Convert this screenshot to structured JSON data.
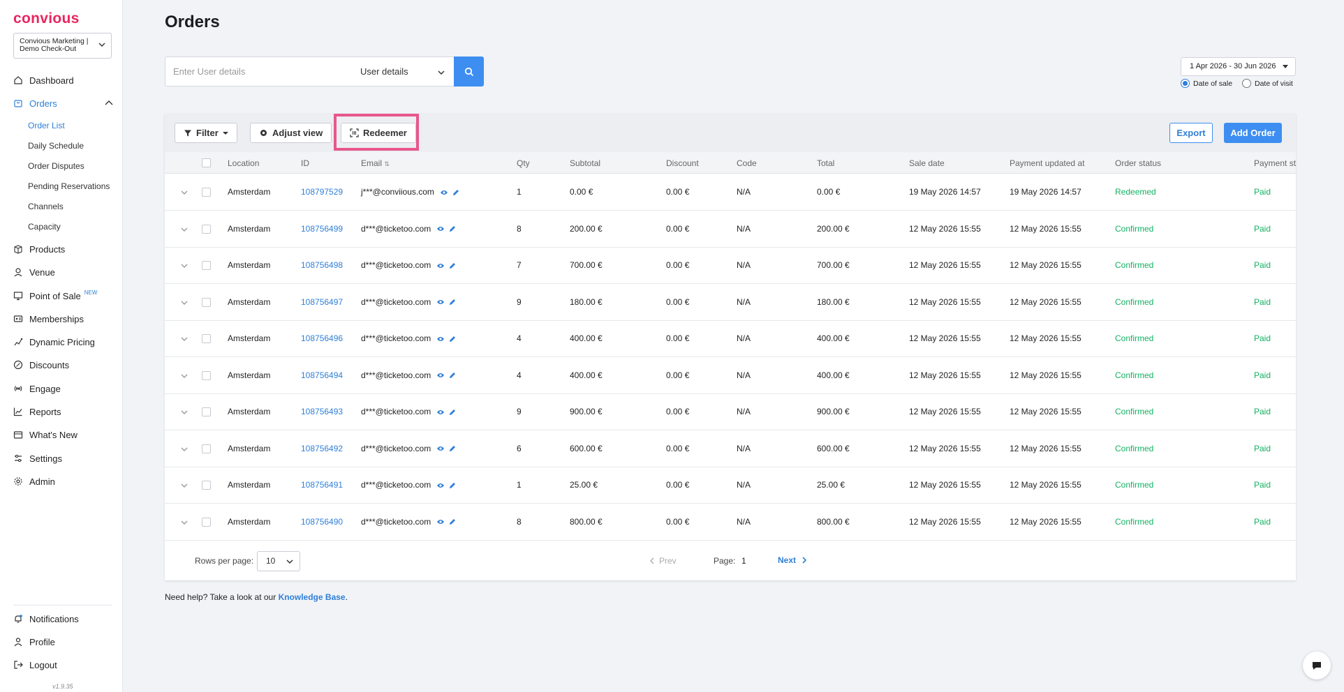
{
  "sidebar": {
    "logo": "convious",
    "account": "Convious Marketing | Demo Check-Out",
    "nav": [
      {
        "label": "Dashboard",
        "icon": "home-icon"
      },
      {
        "label": "Orders",
        "icon": "cart-icon"
      },
      {
        "label": "Products",
        "icon": "box-icon"
      },
      {
        "label": "Venue",
        "icon": "map-pin-icon"
      },
      {
        "label": "Point of Sale",
        "icon": "monitor-icon"
      },
      {
        "label": "Memberships",
        "icon": "id-card-icon"
      },
      {
        "label": "Dynamic Pricing",
        "icon": "pricing-icon"
      },
      {
        "label": "Discounts",
        "icon": "discount-icon"
      },
      {
        "label": "Engage",
        "icon": "broadcast-icon"
      },
      {
        "label": "Reports",
        "icon": "chart-icon"
      },
      {
        "label": "What's New",
        "icon": "gift-icon"
      },
      {
        "label": "Settings",
        "icon": "sliders-icon"
      },
      {
        "label": "Admin",
        "icon": "gear-icon"
      }
    ],
    "orders_sub": [
      "Order List",
      "Daily Schedule",
      "Order Disputes",
      "Pending Reservations",
      "Channels",
      "Capacity"
    ],
    "new_badge": "NEW",
    "bottom": [
      {
        "label": "Notifications",
        "icon": "bell-icon"
      },
      {
        "label": "Profile",
        "icon": "user-icon"
      },
      {
        "label": "Logout",
        "icon": "logout-icon"
      }
    ],
    "version": "v1.9.35"
  },
  "header": {
    "title": "Orders"
  },
  "search": {
    "placeholder": "Enter User details",
    "type": "User details"
  },
  "date_filter": {
    "range": "1 Apr 2026 - 30 Jun 2026",
    "option_sale": "Date of sale",
    "option_visit": "Date of visit",
    "selected": "Date of sale"
  },
  "toolbar": {
    "filter": "Filter",
    "adjust": "Adjust view",
    "redeemer": "Redeemer",
    "export": "Export",
    "add_order": "Add Order"
  },
  "table": {
    "columns": [
      "Location",
      "ID",
      "Email",
      "Qty",
      "Subtotal",
      "Discount",
      "Code",
      "Total",
      "Sale date",
      "Payment updated at",
      "Order status",
      "Payment st"
    ],
    "rows": [
      {
        "location": "Amsterdam",
        "id": "108797529",
        "email": "j***@conviious.com",
        "qty": "1",
        "subtotal": "0.00 €",
        "discount": "0.00 €",
        "code": "N/A",
        "total": "0.00 €",
        "sale_date": "19 May 2026 14:57",
        "payment_updated": "19 May 2026 14:57",
        "status": "Redeemed",
        "payment": "Paid"
      },
      {
        "location": "Amsterdam",
        "id": "108756499",
        "email": "d***@ticketoo.com",
        "qty": "8",
        "subtotal": "200.00 €",
        "discount": "0.00 €",
        "code": "N/A",
        "total": "200.00 €",
        "sale_date": "12 May 2026 15:55",
        "payment_updated": "12 May 2026 15:55",
        "status": "Confirmed",
        "payment": "Paid"
      },
      {
        "location": "Amsterdam",
        "id": "108756498",
        "email": "d***@ticketoo.com",
        "qty": "7",
        "subtotal": "700.00 €",
        "discount": "0.00 €",
        "code": "N/A",
        "total": "700.00 €",
        "sale_date": "12 May 2026 15:55",
        "payment_updated": "12 May 2026 15:55",
        "status": "Confirmed",
        "payment": "Paid"
      },
      {
        "location": "Amsterdam",
        "id": "108756497",
        "email": "d***@ticketoo.com",
        "qty": "9",
        "subtotal": "180.00 €",
        "discount": "0.00 €",
        "code": "N/A",
        "total": "180.00 €",
        "sale_date": "12 May 2026 15:55",
        "payment_updated": "12 May 2026 15:55",
        "status": "Confirmed",
        "payment": "Paid"
      },
      {
        "location": "Amsterdam",
        "id": "108756496",
        "email": "d***@ticketoo.com",
        "qty": "4",
        "subtotal": "400.00 €",
        "discount": "0.00 €",
        "code": "N/A",
        "total": "400.00 €",
        "sale_date": "12 May 2026 15:55",
        "payment_updated": "12 May 2026 15:55",
        "status": "Confirmed",
        "payment": "Paid"
      },
      {
        "location": "Amsterdam",
        "id": "108756494",
        "email": "d***@ticketoo.com",
        "qty": "4",
        "subtotal": "400.00 €",
        "discount": "0.00 €",
        "code": "N/A",
        "total": "400.00 €",
        "sale_date": "12 May 2026 15:55",
        "payment_updated": "12 May 2026 15:55",
        "status": "Confirmed",
        "payment": "Paid"
      },
      {
        "location": "Amsterdam",
        "id": "108756493",
        "email": "d***@ticketoo.com",
        "qty": "9",
        "subtotal": "900.00 €",
        "discount": "0.00 €",
        "code": "N/A",
        "total": "900.00 €",
        "sale_date": "12 May 2026 15:55",
        "payment_updated": "12 May 2026 15:55",
        "status": "Confirmed",
        "payment": "Paid"
      },
      {
        "location": "Amsterdam",
        "id": "108756492",
        "email": "d***@ticketoo.com",
        "qty": "6",
        "subtotal": "600.00 €",
        "discount": "0.00 €",
        "code": "N/A",
        "total": "600.00 €",
        "sale_date": "12 May 2026 15:55",
        "payment_updated": "12 May 2026 15:55",
        "status": "Confirmed",
        "payment": "Paid"
      },
      {
        "location": "Amsterdam",
        "id": "108756491",
        "email": "d***@ticketoo.com",
        "qty": "1",
        "subtotal": "25.00 €",
        "discount": "0.00 €",
        "code": "N/A",
        "total": "25.00 €",
        "sale_date": "12 May 2026 15:55",
        "payment_updated": "12 May 2026 15:55",
        "status": "Confirmed",
        "payment": "Paid"
      },
      {
        "location": "Amsterdam",
        "id": "108756490",
        "email": "d***@ticketoo.com",
        "qty": "8",
        "subtotal": "800.00 €",
        "discount": "0.00 €",
        "code": "N/A",
        "total": "800.00 €",
        "sale_date": "12 May 2026 15:55",
        "payment_updated": "12 May 2026 15:55",
        "status": "Confirmed",
        "payment": "Paid"
      }
    ]
  },
  "pagination": {
    "rows_label": "Rows per page:",
    "rows_value": "10",
    "prev": "Prev",
    "page_label": "Page:",
    "page": "1",
    "next": "Next"
  },
  "help": {
    "text": "Need help? Take a look at our ",
    "link": "Knowledge Base",
    "suffix": "."
  },
  "colors": {
    "accent": "#3d8ef0",
    "brand": "#e8265e",
    "success": "#13b162",
    "highlight": "#e8578a"
  }
}
